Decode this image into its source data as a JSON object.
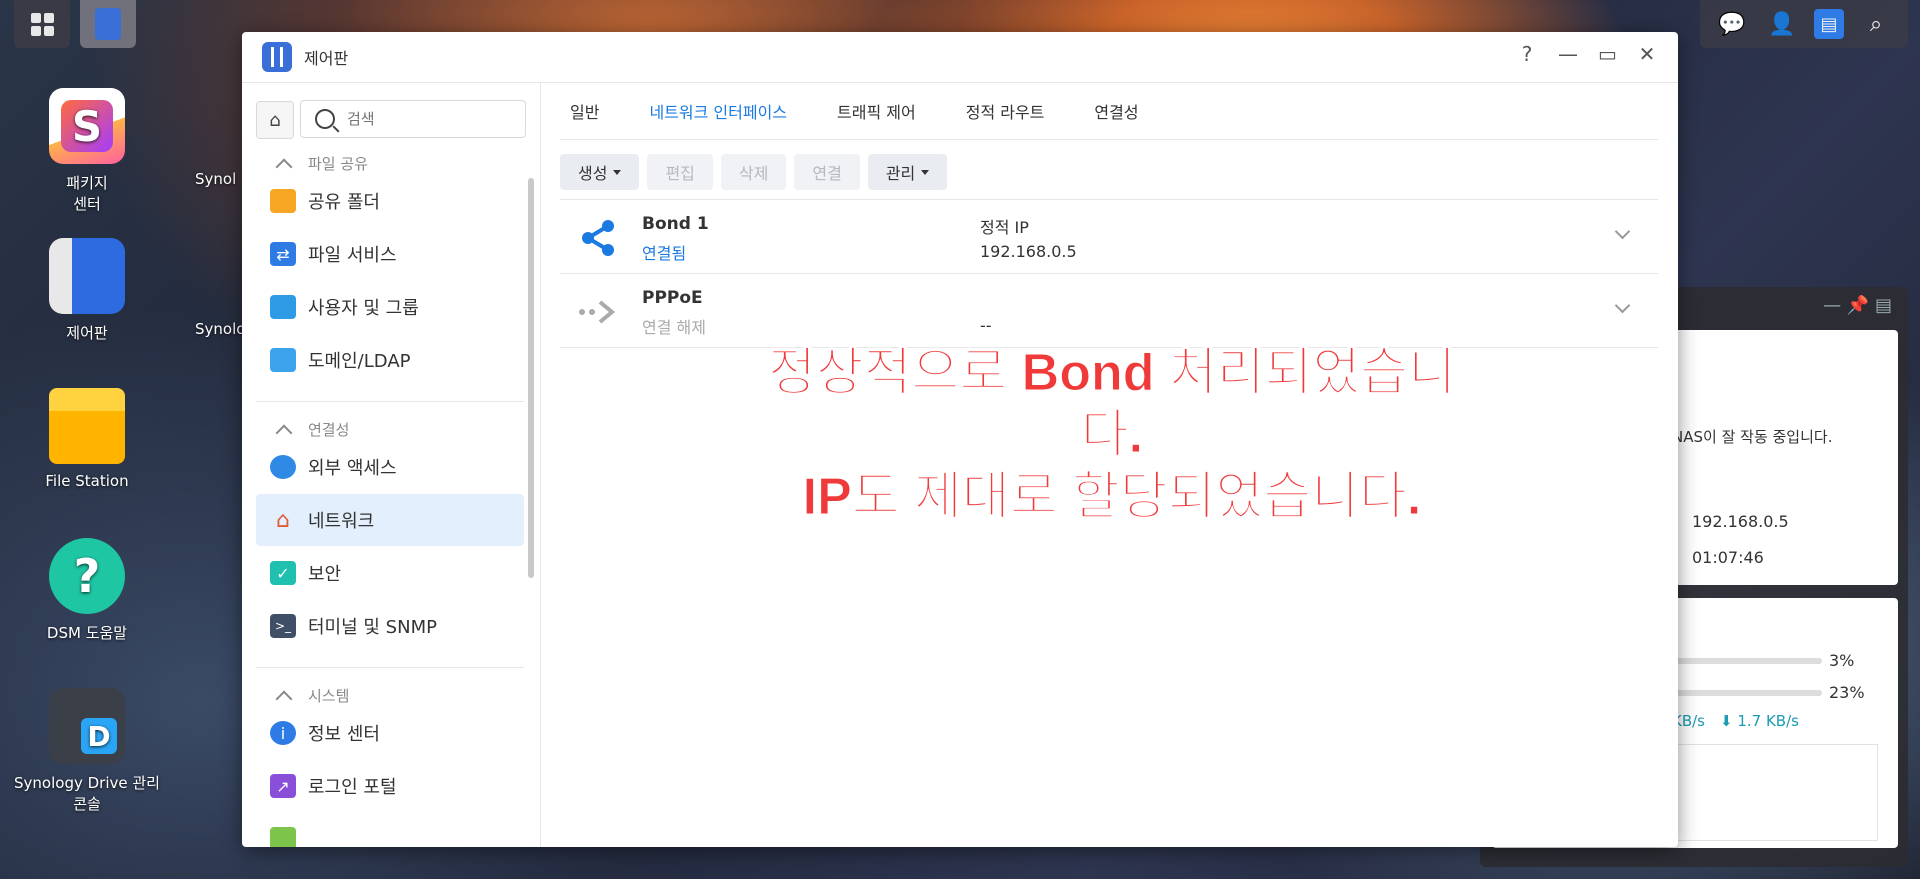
{
  "desktop": {
    "icons": [
      {
        "label": "패키지\n센터",
        "short": "S"
      },
      {
        "label": "제어판"
      },
      {
        "label": "File Station"
      },
      {
        "label": "DSM 도움말",
        "short": "?"
      },
      {
        "label": "Synology Drive 관리\n콘솔",
        "short": "D"
      }
    ],
    "partial_labels": [
      "Synol",
      "Synolo"
    ]
  },
  "widget": {
    "status_text": "NAS이 잘 작동 중입니다.",
    "ip": "192.168.0.5",
    "uptime": "01:07:46",
    "cpu": "3%",
    "ram": "23%",
    "net_up": "KB/s",
    "net_down": "1.7 KB/s"
  },
  "window": {
    "title": "제어판",
    "controls": {
      "help": "?",
      "minimize": "—",
      "maximize": "▭",
      "close": "✕"
    }
  },
  "sidebar": {
    "search_placeholder": "검색",
    "sections": [
      {
        "label": "파일 공유",
        "items": [
          "공유 폴더",
          "파일 서비스",
          "사용자 및 그룹",
          "도메인/LDAP"
        ]
      },
      {
        "label": "연결성",
        "items": [
          "외부 액세스",
          "네트워크",
          "보안",
          "터미널 및 SNMP"
        ]
      },
      {
        "label": "시스템",
        "items": [
          "정보 센터",
          "로그인 포털"
        ]
      }
    ],
    "active_item": "네트워크"
  },
  "tabs": [
    "일반",
    "네트워크 인터페이스",
    "트래픽 제어",
    "정적 라우트",
    "연결성"
  ],
  "active_tab": "네트워크 인터페이스",
  "toolbar": {
    "create": "생성",
    "edit": "편집",
    "delete": "삭제",
    "connect": "연결",
    "manage": "관리"
  },
  "interfaces": [
    {
      "name": "Bond 1",
      "status": "연결됨",
      "type": "정적 IP",
      "ip": "192.168.0.5"
    },
    {
      "name": "PPPoE",
      "status": "연결 해제",
      "type": "",
      "ip": "--"
    }
  ],
  "annotation": {
    "line1": "정상적으로 Bond 처리되었습니다.",
    "line2": "IP도 제대로 할당되었습니다."
  },
  "colors": {
    "accent": "#1b7ae0",
    "annotation": "#f03a3a"
  }
}
